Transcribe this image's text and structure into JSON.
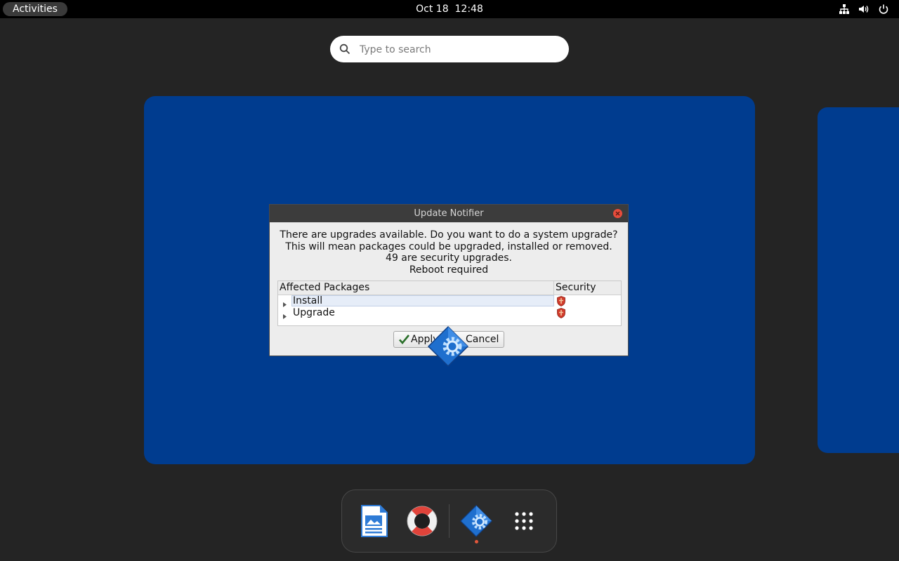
{
  "topbar": {
    "activities_label": "Activities",
    "date": "Oct 18",
    "time": "12:48",
    "tray_icons": [
      "network-icon",
      "volume-icon",
      "power-icon"
    ]
  },
  "search": {
    "placeholder": "Type to search"
  },
  "dialog": {
    "title": "Update Notifier",
    "message_lines": [
      "There are upgrades available. Do you want to do a system upgrade?",
      "This will mean packages could be upgraded, installed or removed.",
      "49 are security upgrades.",
      "Reboot required"
    ],
    "table": {
      "columns": [
        "Affected Packages",
        "Security"
      ],
      "rows": [
        {
          "label": "Install",
          "security_icon": "shield-icon",
          "selected": true
        },
        {
          "label": "Upgrade",
          "security_icon": "shield-icon",
          "selected": false
        }
      ]
    },
    "buttons": {
      "apply": "Apply",
      "cancel": "Cancel"
    }
  },
  "dock": {
    "apps": [
      {
        "name": "libreoffice-impress-icon"
      },
      {
        "name": "help-lifebuoy-icon"
      },
      {
        "name": "software-updater-icon",
        "running": true
      },
      {
        "name": "show-apps-grid-icon"
      }
    ]
  },
  "colors": {
    "workspace_bg": "#003c8f",
    "desktop_bg": "#242424",
    "topbar_bg": "#000000",
    "running_dot": "#e2573b"
  }
}
